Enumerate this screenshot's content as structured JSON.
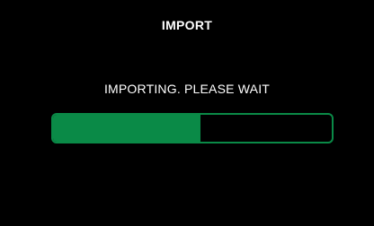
{
  "dialog": {
    "title": "IMPORT",
    "message": "IMPORTING. PLEASE WAIT"
  },
  "progress": {
    "fraction": 0.53
  },
  "colors": {
    "background": "#000000",
    "text": "#ffffff",
    "accent": "#0a8a47"
  }
}
